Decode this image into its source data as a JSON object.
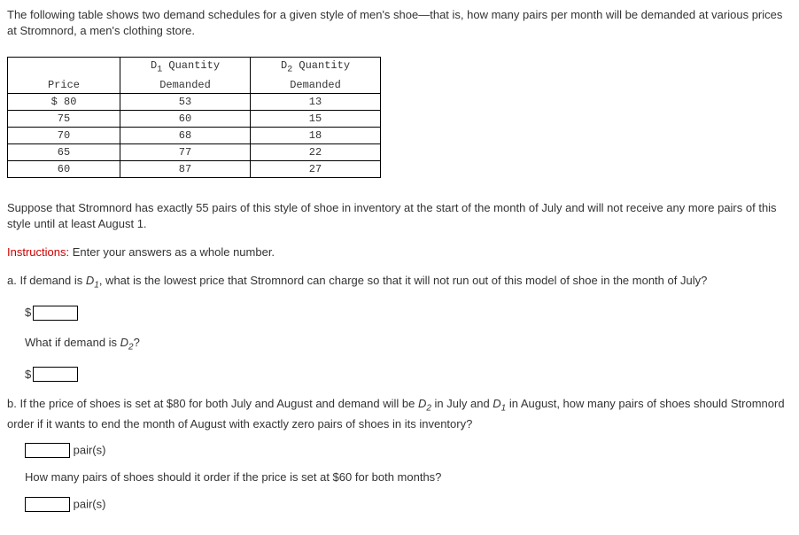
{
  "intro": "The following table shows two demand schedules for a given style of men's shoe—that is, how many pairs per month will be demanded at various prices at Stromnord, a men's clothing store.",
  "table": {
    "headers": {
      "price": "Price",
      "d1_line1": "D",
      "d1_sub": "1",
      "d1_line2": " Quantity",
      "d1_line3": "Demanded",
      "d2_line1": "D",
      "d2_sub": "2",
      "d2_line2": " Quantity",
      "d2_line3": "Demanded"
    },
    "rows": [
      {
        "price": "$ 80",
        "d1": "53",
        "d2": "13"
      },
      {
        "price": "75",
        "d1": "60",
        "d2": "15"
      },
      {
        "price": "70",
        "d1": "68",
        "d2": "18"
      },
      {
        "price": "65",
        "d1": "77",
        "d2": "22"
      },
      {
        "price": "60",
        "d1": "87",
        "d2": "27"
      }
    ]
  },
  "para1": "Suppose that Stromnord has exactly 55 pairs of this style of shoe in inventory at the start of the month of July and will not receive any more pairs of this style until at least August 1.",
  "instructions_label": "Instructions:",
  "instructions_text": " Enter your answers as a whole number.",
  "qa_part1": "a. If demand is ",
  "qa_d1": "D",
  "qa_d1_sub": "1",
  "qa_part2": ", what is the lowest price that Stromnord can charge so that it will not run out of this model of shoe in the month of July?",
  "dollar": "$",
  "what_if_part1": "What if demand is ",
  "what_if_d2": "D",
  "what_if_d2_sub": "2",
  "what_if_part2": "?",
  "qb_part1": "b. If the price of shoes is set at $80 for both July and August and demand will be ",
  "qb_d2": "D",
  "qb_d2_sub": "2",
  "qb_part2": " in July and ",
  "qb_d1": "D",
  "qb_d1_sub": "1",
  "qb_part3": " in August, how many pairs of shoes should Stromnord order if it wants to end the month of August with exactly zero pairs of shoes in its inventory?",
  "pairs_label": "pair(s)",
  "qb2": "How many pairs of shoes should it order if the price is set at $60 for both months?"
}
